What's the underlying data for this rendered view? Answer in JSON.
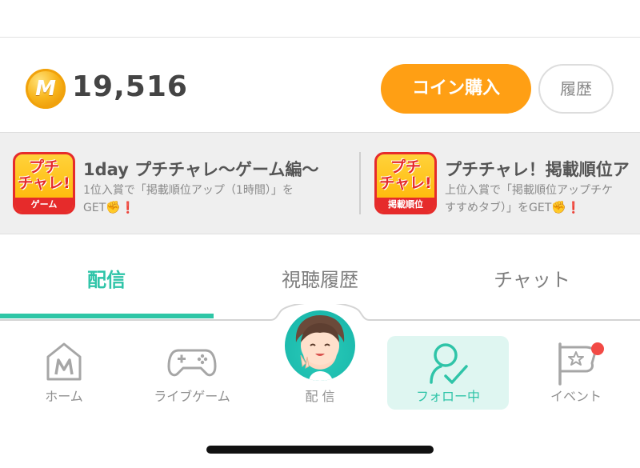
{
  "wallet": {
    "coin_symbol": "M",
    "coin_amount": "19,516",
    "buy_label": "コイン購入",
    "history_label": "履歴"
  },
  "banners": [
    {
      "icon_text_top": "プチ",
      "icon_text_bottom": "チャレ!",
      "icon_band": "ゲーム",
      "title": "1day プチチャレ～ゲーム編～",
      "desc_line1": "1位入賞で「掲載順位アップ（1時間）」を",
      "desc_line2": "GET"
    },
    {
      "icon_text_top": "プチ",
      "icon_text_bottom": "チャレ!",
      "icon_band": "掲載順位",
      "title": "プチチャレ！掲載順位ア",
      "desc_line1": "上位入賞で「掲載順位アップチケ",
      "desc_line2": "すすめタブ）」をGET"
    }
  ],
  "tabs": [
    {
      "label": "配信",
      "active": true
    },
    {
      "label": "視聴履歴",
      "active": false
    },
    {
      "label": "チャット",
      "active": false
    }
  ],
  "bottom_nav": [
    {
      "label": "ホーム",
      "icon": "home-icon"
    },
    {
      "label": "ライブゲーム",
      "icon": "gamepad-icon"
    },
    {
      "label": "配 信",
      "icon": "avatar"
    },
    {
      "label": "フォロー中",
      "icon": "follow-icon",
      "active": true
    },
    {
      "label": "イベント",
      "icon": "flag-icon",
      "badge": true
    }
  ],
  "colors": {
    "accent": "#2fc4a8",
    "orange": "#ff9f14",
    "badge_red": "#f24a45"
  }
}
